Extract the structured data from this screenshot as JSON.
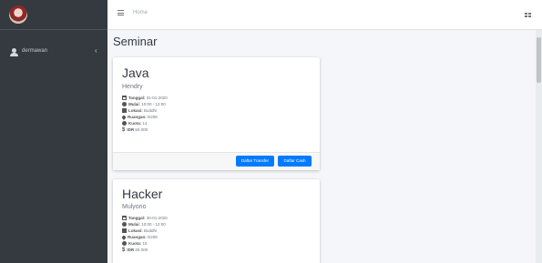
{
  "topbar": {
    "home_label": "Home"
  },
  "sidebar": {
    "user_name": "dermawan"
  },
  "page": {
    "title": "Seminar"
  },
  "colors": {
    "sidebar": "#343a40",
    "accent": "#007bff",
    "background": "#f4f6f9"
  },
  "icons": [
    "hamburger-icon",
    "grid-icon",
    "user-icon",
    "chevron-left-icon",
    "calendar-icon",
    "clock-icon",
    "building-icon",
    "map-pin-icon",
    "copyright-icon",
    "dollar-icon"
  ],
  "labels": {
    "tanggal": "Tanggal:",
    "mulai": "Mulai:",
    "lokasi": "Lokasi:",
    "ruangan": "Ruangan:",
    "kuota": "Kuota:",
    "idr": "IDR"
  },
  "seminars": [
    {
      "title": "Java",
      "speaker": "Hendry",
      "tanggal": "31-01-2020",
      "mulai": "10:00 - 12:00",
      "lokasi": "Buddhi",
      "ruangan": "D208",
      "kuota": "14",
      "idr": "50.000",
      "transfer_label": "Daftar Transfer",
      "cash_label": "Daftar Cash"
    },
    {
      "title": "Hacker",
      "speaker": "Mulyono",
      "tanggal": "30-01-2020",
      "mulai": "10:00 - 12:00",
      "lokasi": "Buddhi",
      "ruangan": "D208",
      "kuota": "15",
      "idr": "25.000"
    }
  ]
}
